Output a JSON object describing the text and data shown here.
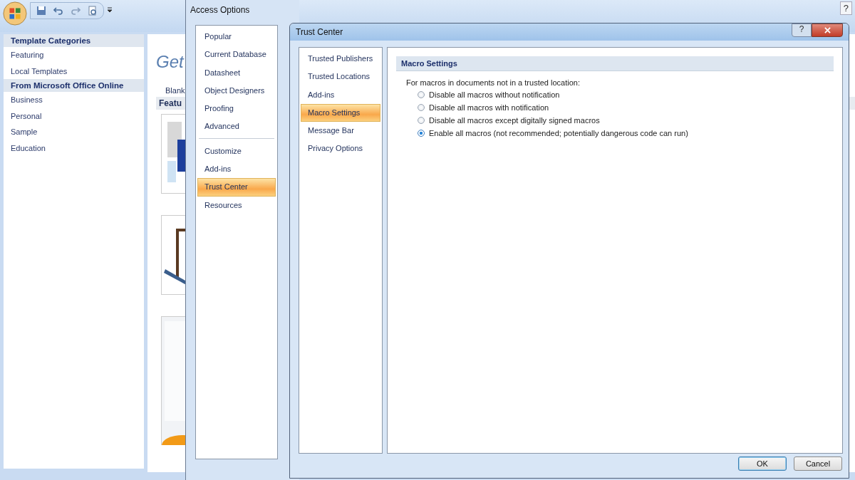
{
  "app": {
    "categories": [
      {
        "kind": "header",
        "label": "Template Categories"
      },
      {
        "kind": "item",
        "label": "Featuring"
      },
      {
        "kind": "item",
        "label": "Local Templates"
      },
      {
        "kind": "header",
        "label": "From Microsoft Office Online"
      },
      {
        "kind": "item",
        "label": "Business"
      },
      {
        "kind": "item",
        "label": "Personal"
      },
      {
        "kind": "item",
        "label": "Sample"
      },
      {
        "kind": "item",
        "label": "Education"
      }
    ],
    "heading": "Get",
    "blank_label": "Blank",
    "section": "Featu",
    "help": "?"
  },
  "options": {
    "title": "Access Options",
    "nav_groups": [
      [
        {
          "label": "Popular",
          "selected": false
        },
        {
          "label": "Current Database",
          "selected": false
        },
        {
          "label": "Datasheet",
          "selected": false
        },
        {
          "label": "Object Designers",
          "selected": false
        },
        {
          "label": "Proofing",
          "selected": false
        },
        {
          "label": "Advanced",
          "selected": false
        }
      ],
      [
        {
          "label": "Customize",
          "selected": false
        },
        {
          "label": "Add-ins",
          "selected": false
        },
        {
          "label": "Trust Center",
          "selected": true
        },
        {
          "label": "Resources",
          "selected": false
        }
      ]
    ]
  },
  "trust_center": {
    "title": "Trust Center",
    "help": "?",
    "nav": [
      {
        "label": "Trusted Publishers",
        "selected": false
      },
      {
        "label": "Trusted Locations",
        "selected": false
      },
      {
        "label": "Add-ins",
        "selected": false
      },
      {
        "label": "Macro Settings",
        "selected": true
      },
      {
        "label": "Message Bar",
        "selected": false
      },
      {
        "label": "Privacy Options",
        "selected": false
      }
    ],
    "section": "Macro Settings",
    "prompt": "For macros in documents not in a trusted location:",
    "options": [
      {
        "label": "Disable all macros without notification",
        "selected": false
      },
      {
        "label": "Disable all macros with notification",
        "selected": false
      },
      {
        "label": "Disable all macros except digitally signed macros",
        "selected": false
      },
      {
        "label": "Enable all macros (not recommended; potentially dangerous code can run)",
        "selected": true
      }
    ],
    "buttons": [
      {
        "label": "OK",
        "default": true
      },
      {
        "label": "Cancel",
        "default": false
      }
    ]
  }
}
